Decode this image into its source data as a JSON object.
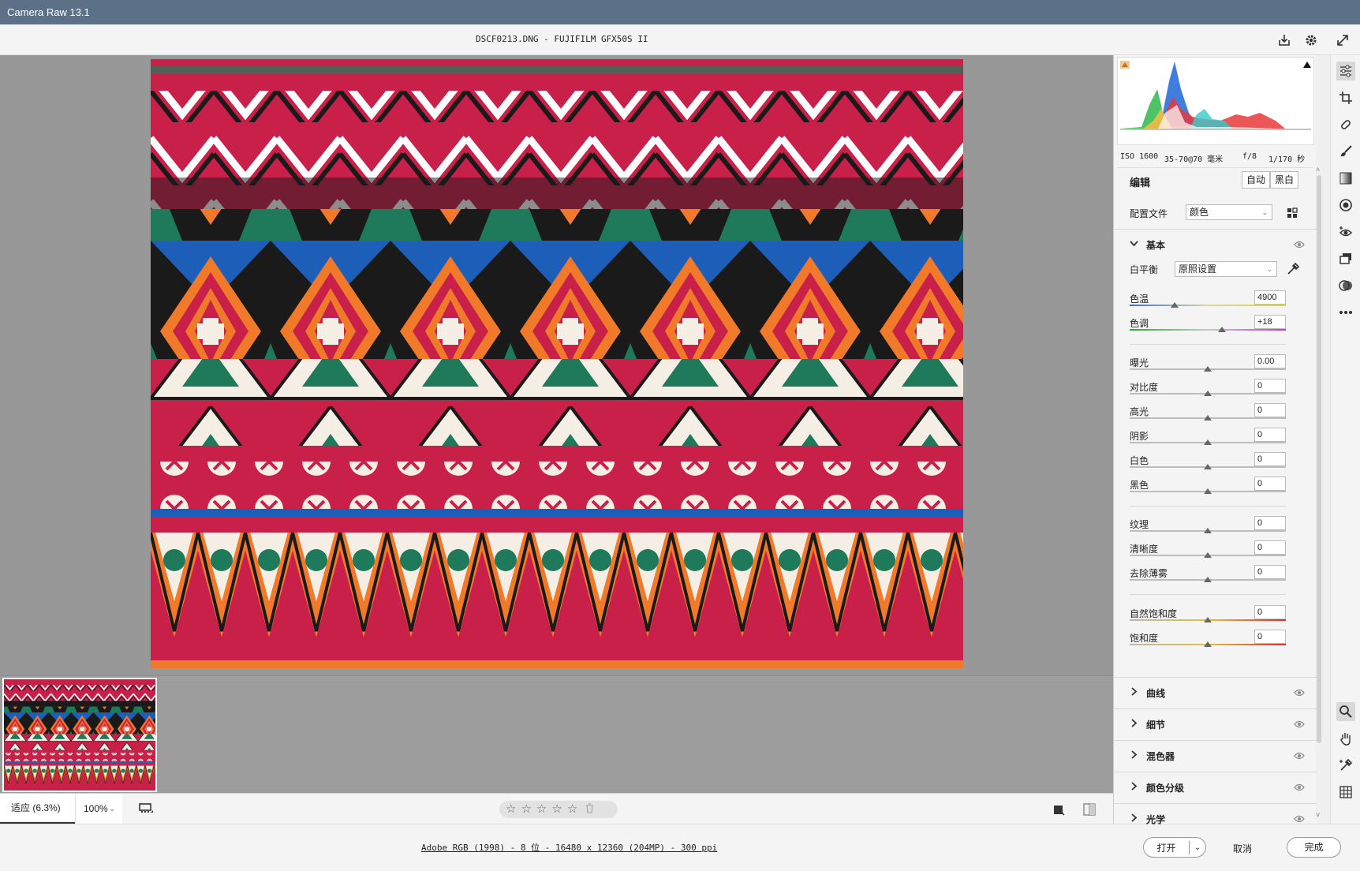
{
  "window": {
    "title": "Camera Raw 13.1"
  },
  "header": {
    "file_title": "DSCF0213.DNG -  FUJIFILM GFX50S II"
  },
  "bottom": {
    "zoom_fit": "适应 (6.3%)",
    "zoom_percent": "100%",
    "rating_stars": 0
  },
  "footer": {
    "file_info": "Adobe RGB (1998) - 8 位 - 16480 x 12360 (204MP) - 300 ppi",
    "open_label": "打开",
    "cancel_label": "取消",
    "done_label": "完成"
  },
  "camera_info": {
    "iso": "ISO 1600",
    "lens": "35-70@70 毫米",
    "aperture": "f/8",
    "shutter": "1/170 秒"
  },
  "edit": {
    "title": "编辑",
    "auto_label": "自动",
    "bw_label": "黑白",
    "profile_label": "配置文件",
    "profile_value": "颜色"
  },
  "basic": {
    "title": "基本",
    "wb_label": "白平衡",
    "wb_value": "原照设置",
    "sliders": [
      {
        "label": "色温",
        "value": "4900",
        "pos": 0.29
      },
      {
        "label": "色调",
        "value": "+18",
        "pos": 0.59
      },
      {
        "label": "曝光",
        "value": "0.00",
        "pos": 0.5
      },
      {
        "label": "对比度",
        "value": "0",
        "pos": 0.5
      },
      {
        "label": "高光",
        "value": "0",
        "pos": 0.5
      },
      {
        "label": "阴影",
        "value": "0",
        "pos": 0.5
      },
      {
        "label": "白色",
        "value": "0",
        "pos": 0.5
      },
      {
        "label": "黑色",
        "value": "0",
        "pos": 0.5
      },
      {
        "label": "纹理",
        "value": "0",
        "pos": 0.5
      },
      {
        "label": "清晰度",
        "value": "0",
        "pos": 0.5
      },
      {
        "label": "去除薄雾",
        "value": "0",
        "pos": 0.5
      },
      {
        "label": "自然饱和度",
        "value": "0",
        "pos": 0.5
      },
      {
        "label": "饱和度",
        "value": "0",
        "pos": 0.5
      }
    ]
  },
  "sections": [
    {
      "name": "曲线"
    },
    {
      "name": "细节"
    },
    {
      "name": "混色器"
    },
    {
      "name": "颜色分级"
    },
    {
      "name": "光学"
    }
  ],
  "colors": {
    "titlebar": "#5c7188",
    "photo_red": "#c9204a",
    "photo_orange": "#f07a2a",
    "photo_blue": "#1d5fb8",
    "photo_green": "#1e7a5a"
  }
}
